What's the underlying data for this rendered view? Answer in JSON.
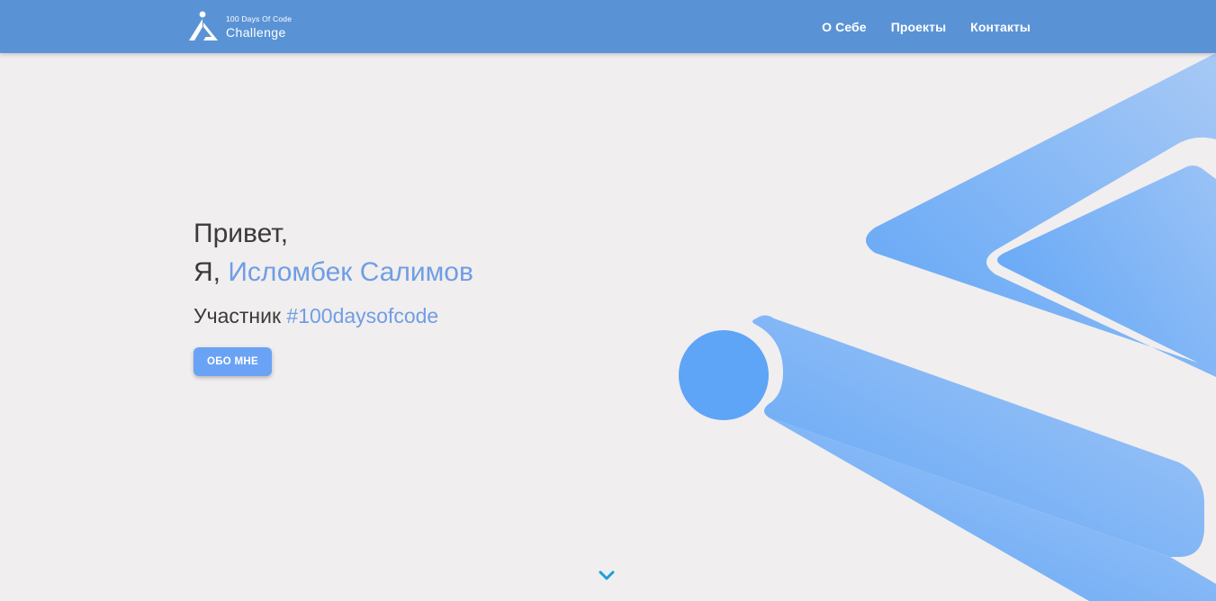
{
  "navbar": {
    "brand": {
      "small_text": "100 Days Of Code",
      "big_text": "Challenge",
      "logo_icon": "100-days-logo-icon"
    },
    "links": [
      {
        "label": "О Себе"
      },
      {
        "label": "Проекты"
      },
      {
        "label": "Контакты"
      }
    ]
  },
  "hero": {
    "greeting": "Привет,",
    "name_prefix": "Я, ",
    "name": "Исломбек Салимов",
    "role_prefix": "Участник ",
    "role_tag": "#100daysofcode",
    "cta_label": "ОБО МНЕ",
    "scroll_icon": "chevron-down-icon",
    "art_icon": "logo-triangle-decoration"
  },
  "colors": {
    "navbar_bg": "#5a93d5",
    "page_bg": "#f1eeef",
    "accent_text": "#6f9ee4",
    "button_bg": "#6aa3f5",
    "art_blue": "#5ea4f7",
    "chevron": "#1b9fd8"
  }
}
